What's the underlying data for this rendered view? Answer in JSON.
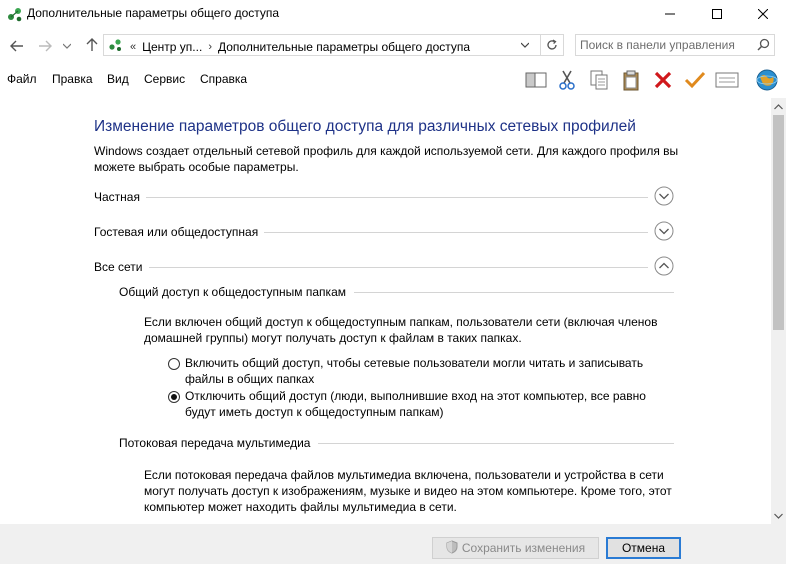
{
  "window": {
    "title": "Дополнительные параметры общего доступа",
    "icon": "network-sharing-icon"
  },
  "address_bar": {
    "prefix": "«",
    "crumbs": [
      "Центр уп...",
      "Дополнительные параметры общего доступа"
    ]
  },
  "search": {
    "placeholder": "Поиск в панели управления"
  },
  "menu": [
    "Файл",
    "Правка",
    "Вид",
    "Сервис",
    "Справка"
  ],
  "toolbar": [
    "layout-pane-icon",
    "cut-icon",
    "copy-icon",
    "paste-icon",
    "delete-icon",
    "checkmark-icon",
    "properties-icon",
    "globe-icon"
  ],
  "main": {
    "heading": "Изменение параметров общего доступа для различных сетевых профилей",
    "intro": "Windows создает отдельный сетевой профиль для каждой используемой сети. Для каждого профиля вы можете выбрать особые параметры.",
    "profiles": [
      {
        "label": "Частная",
        "expanded": false
      },
      {
        "label": "Гостевая или общедоступная",
        "expanded": false
      },
      {
        "label": "Все сети",
        "expanded": true
      }
    ],
    "public_folders": {
      "title": "Общий доступ к общедоступным папкам",
      "description": "Если включен общий доступ к общедоступным папкам, пользователи сети (включая членов домашней группы) могут получать доступ к файлам в таких папках.",
      "options": [
        {
          "label": "Включить общий доступ, чтобы сетевые пользователи могли читать и записывать файлы в общих папках",
          "checked": false
        },
        {
          "label": "Отключить общий доступ (люди, выполнившие вход на этот компьютер, все равно будут иметь доступ к общедоступным папкам)",
          "checked": true
        }
      ]
    },
    "media_streaming": {
      "title": "Потоковая передача мультимедиа",
      "description": "Если потоковая передача файлов мультимедиа включена, пользователи и устройства в сети могут получать доступ к изображениям, музыке и видео на этом компьютере. Кроме того, этот компьютер может находить файлы мультимедиа в сети."
    }
  },
  "footer": {
    "save_label": "Сохранить изменения",
    "cancel_label": "Отмена"
  },
  "colors": {
    "heading": "#1e3287",
    "accent": "#2a7bd4"
  }
}
